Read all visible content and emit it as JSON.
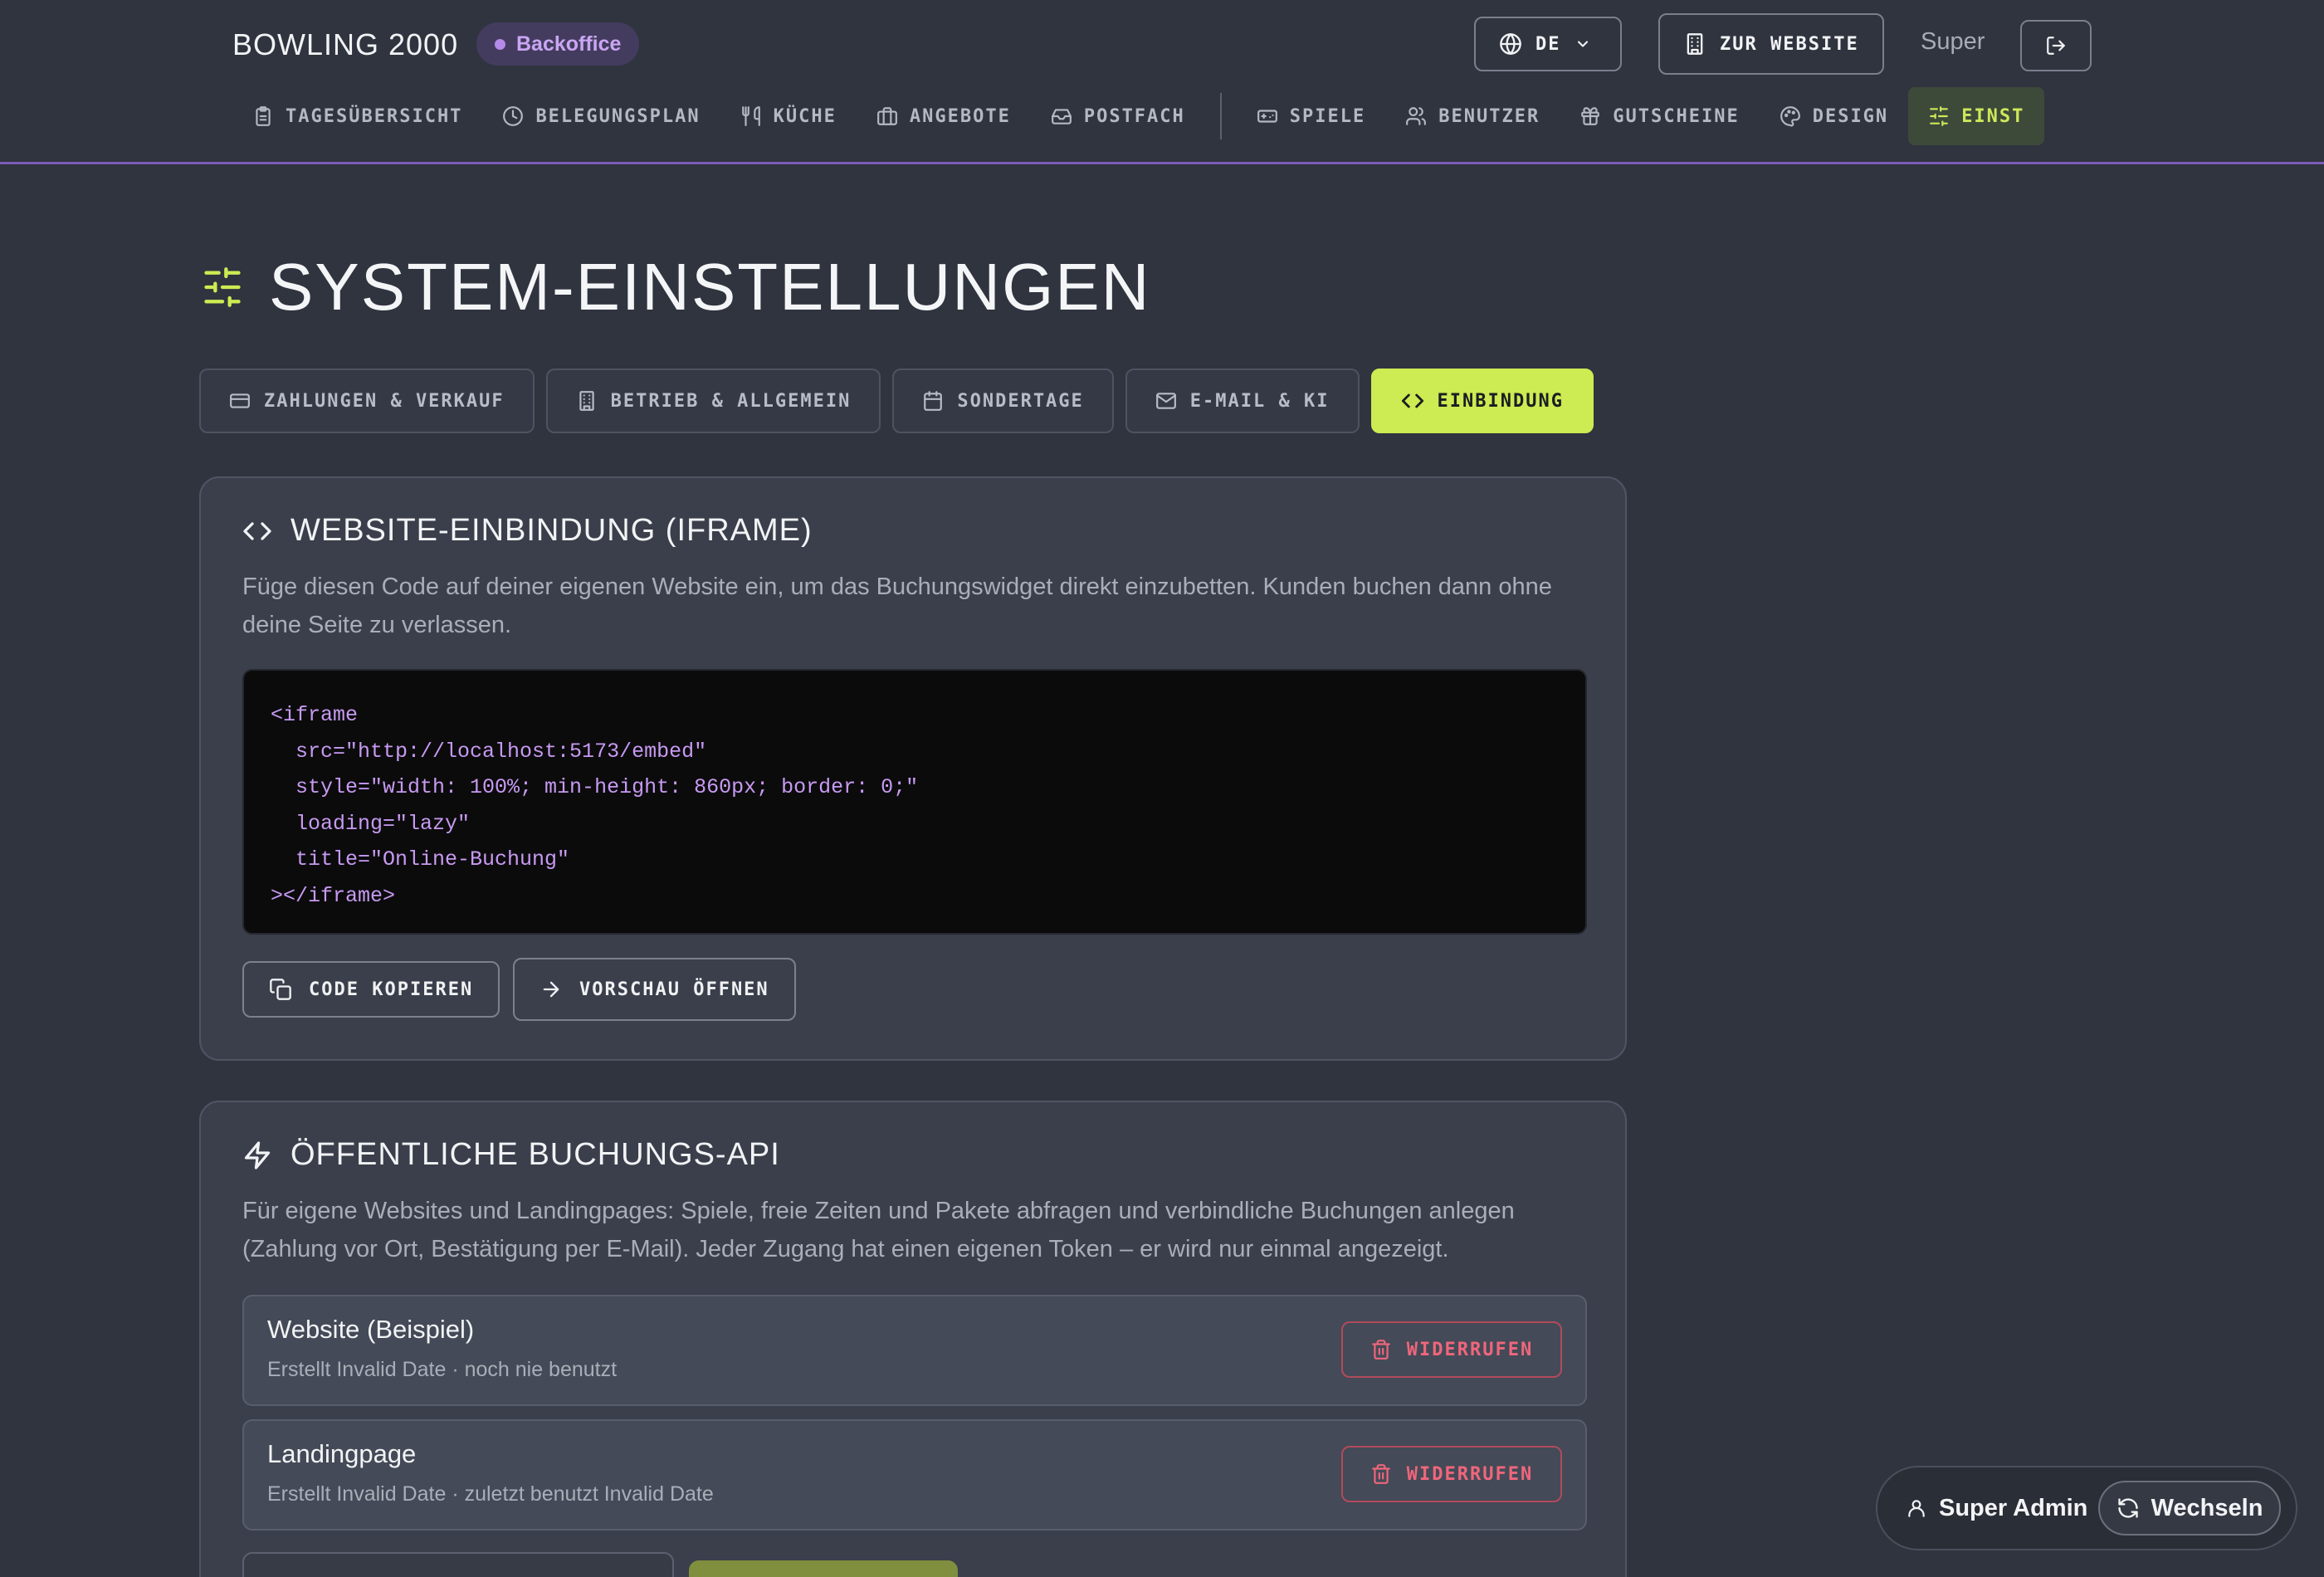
{
  "header": {
    "brand": "BOWLING 2000",
    "badge": "Backoffice",
    "language": "DE",
    "website_button": "ZUR WEBSITE",
    "user_name": "Super"
  },
  "nav": {
    "items": [
      {
        "label": "TAGESÜBERSICHT",
        "icon": "clipboard-icon"
      },
      {
        "label": "BELEGUNGSPLAN",
        "icon": "clock-icon"
      },
      {
        "label": "KÜCHE",
        "icon": "utensils-icon"
      },
      {
        "label": "ANGEBOTE",
        "icon": "briefcase-icon"
      },
      {
        "label": "POSTFACH",
        "icon": "inbox-icon"
      },
      {
        "label": "SPIELE",
        "icon": "gamepad-icon"
      },
      {
        "label": "BENUTZER",
        "icon": "users-icon"
      },
      {
        "label": "GUTSCHEINE",
        "icon": "gift-icon"
      },
      {
        "label": "DESIGN",
        "icon": "palette-icon"
      },
      {
        "label": "EINST",
        "icon": "sliders-icon",
        "active": true
      }
    ]
  },
  "page": {
    "title": "SYSTEM-EINSTELLUNGEN"
  },
  "tabs": [
    {
      "label": "ZAHLUNGEN & VERKAUF",
      "icon": "credit-card-icon"
    },
    {
      "label": "BETRIEB & ALLGEMEIN",
      "icon": "building-icon"
    },
    {
      "label": "SONDERTAGE",
      "icon": "calendar-icon"
    },
    {
      "label": "E-MAIL & KI",
      "icon": "mail-icon"
    },
    {
      "label": "EINBINDUNG",
      "icon": "code-icon",
      "active": true
    }
  ],
  "embed": {
    "title": "WEBSITE-EINBINDUNG (IFRAME)",
    "description": "Füge diesen Code auf deiner eigenen Website ein, um das Buchungswidget direkt einzubetten. Kunden buchen dann ohne deine Seite zu verlassen.",
    "code": "<iframe\n  src=\"http://localhost:5173/embed\"\n  style=\"width: 100%; min-height: 860px; border: 0;\"\n  loading=\"lazy\"\n  title=\"Online-Buchung\"\n></iframe>",
    "copy_button": "CODE KOPIEREN",
    "preview_button": "VORSCHAU ÖFFNEN"
  },
  "api": {
    "title": "ÖFFENTLICHE BUCHUNGS-API",
    "description": "Für eigene Websites und Landingpages: Spiele, freie Zeiten und Pakete abfragen und verbindliche Buchungen anlegen (Zahlung vor Ort, Bestätigung per E-Mail). Jeder Zugang hat einen eigenen Token – er wird nur einmal angezeigt.",
    "tokens": [
      {
        "name": "Website (Beispiel)",
        "meta": "Erstellt Invalid Date · noch nie benutzt",
        "revoke": "WIDERRUFEN"
      },
      {
        "name": "Landingpage",
        "meta": "Erstellt Invalid Date · zuletzt benutzt Invalid Date",
        "revoke": "WIDERRUFEN"
      }
    ]
  },
  "float_bar": {
    "user": "Super Admin",
    "switch": "Wechseln"
  },
  "colors": {
    "accent": "#cdeb52",
    "brand_purple": "#7d5db8",
    "danger": "#f0667c",
    "background": "#2f343f"
  }
}
